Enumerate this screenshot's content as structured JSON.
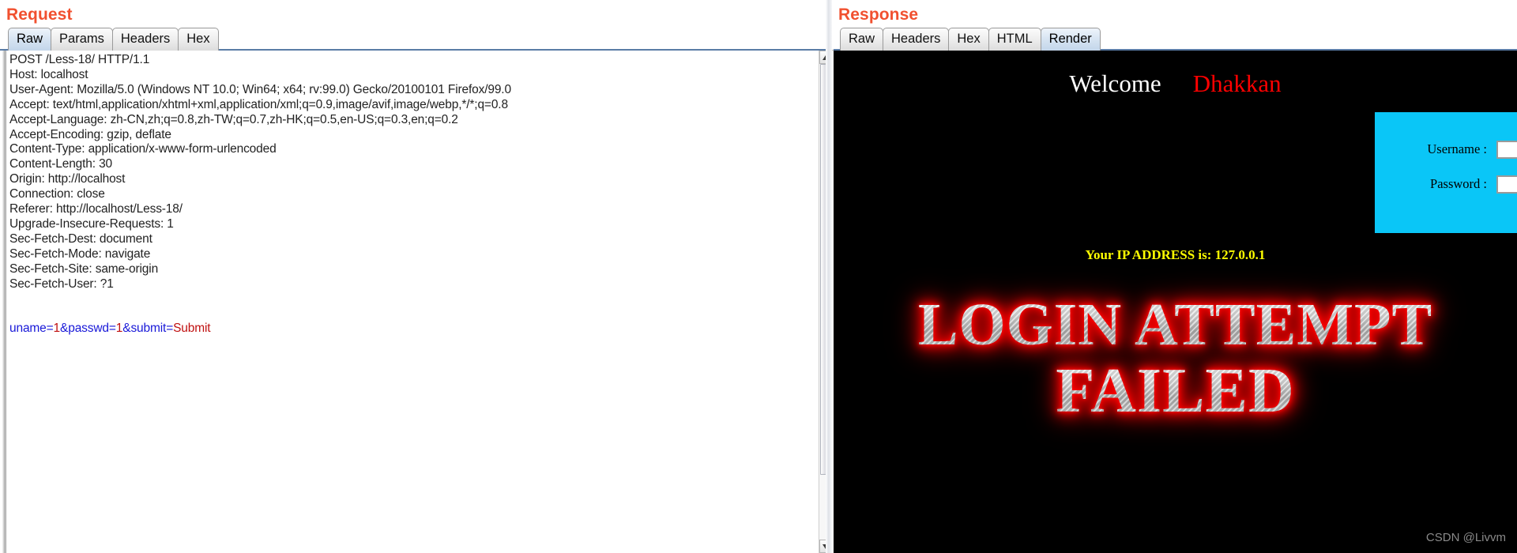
{
  "request": {
    "title": "Request",
    "tabs": [
      {
        "label": "Raw",
        "selected": true
      },
      {
        "label": "Params",
        "selected": false
      },
      {
        "label": "Headers",
        "selected": false
      },
      {
        "label": "Hex",
        "selected": false
      }
    ],
    "raw_lines": [
      "POST /Less-18/ HTTP/1.1",
      "Host: localhost",
      "User-Agent: Mozilla/5.0 (Windows NT 10.0; Win64; x64; rv:99.0) Gecko/20100101 Firefox/99.0",
      "Accept: text/html,application/xhtml+xml,application/xml;q=0.9,image/avif,image/webp,*/*;q=0.8",
      "Accept-Language: zh-CN,zh;q=0.8,zh-TW;q=0.7,zh-HK;q=0.5,en-US;q=0.3,en;q=0.2",
      "Accept-Encoding: gzip, deflate",
      "Content-Type: application/x-www-form-urlencoded",
      "Content-Length: 30",
      "Origin: http://localhost",
      "Connection: close",
      "Referer: http://localhost/Less-18/",
      "Upgrade-Insecure-Requests: 1",
      "Sec-Fetch-Dest: document",
      "Sec-Fetch-Mode: navigate",
      "Sec-Fetch-Site: same-origin",
      "Sec-Fetch-User: ?1"
    ],
    "body": {
      "full": "uname=1&passwd=1&submit=Submit",
      "tokens": [
        {
          "text": "uname=",
          "kind": "key"
        },
        {
          "text": "1",
          "kind": "value"
        },
        {
          "text": "&passwd=",
          "kind": "key"
        },
        {
          "text": "1",
          "kind": "value"
        },
        {
          "text": "&submit=",
          "kind": "key"
        },
        {
          "text": "Submit",
          "kind": "value"
        }
      ]
    },
    "scrollbar": {
      "up_icon": "triangle-up-icon",
      "down_icon": "triangle-down-icon"
    }
  },
  "response": {
    "title": "Response",
    "tabs": [
      {
        "label": "Raw",
        "selected": false
      },
      {
        "label": "Headers",
        "selected": false
      },
      {
        "label": "Hex",
        "selected": false
      },
      {
        "label": "HTML",
        "selected": false
      },
      {
        "label": "Render",
        "selected": true
      }
    ],
    "render": {
      "welcome": "Welcome",
      "user": "Dhakkan",
      "login_box": {
        "username_label": "Username :",
        "password_label": "Password :",
        "username_value": "",
        "password_value": ""
      },
      "ip_text": "Your IP ADDRESS is: 127.0.0.1",
      "fail_line1": "LOGIN ATTEMPT",
      "fail_line2": "FAILED",
      "watermark": "CSDN @Livvm"
    }
  },
  "colors": {
    "panel_title": "#f1502f",
    "render_bg": "#000000",
    "login_box_bg": "#0ac6f7",
    "ip_text": "#ffff00",
    "user_name": "#fe0000",
    "param_key": "#1818d8",
    "param_value": "#c01010",
    "fail_glow": "#ff0000",
    "fail_fill": "#c6c6c6"
  }
}
